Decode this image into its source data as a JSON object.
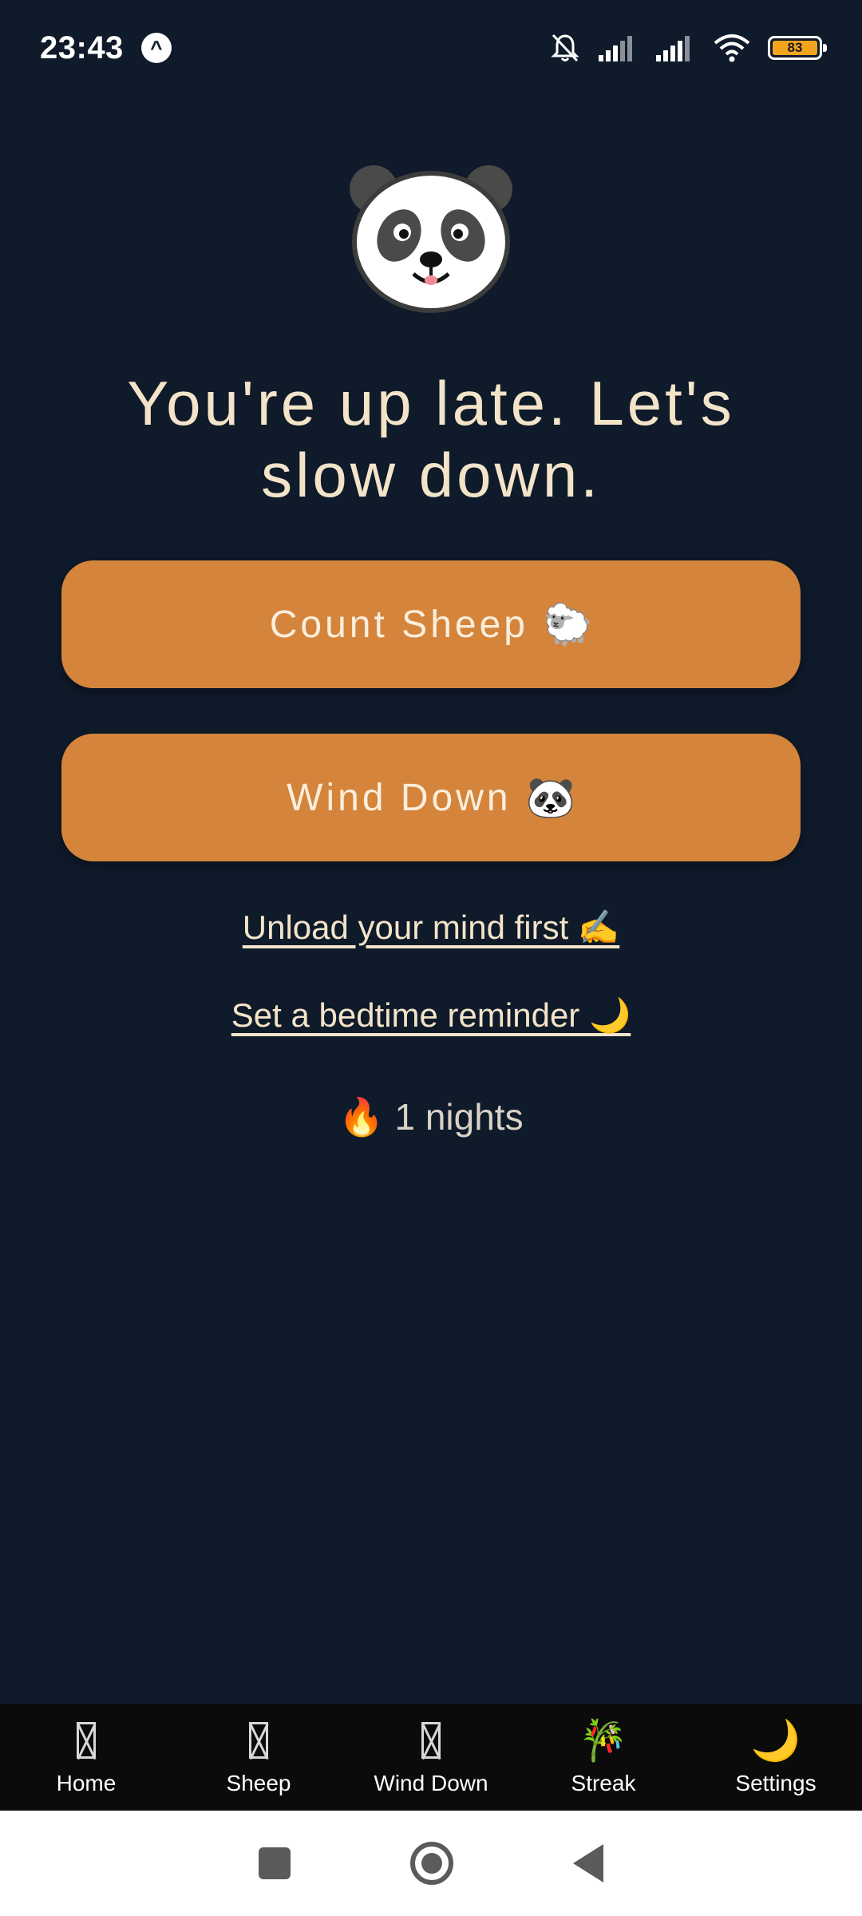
{
  "status_bar": {
    "time": "23:43",
    "battery_percent": "83",
    "app_badge_glyph": "^",
    "icons": [
      "app-notification-icon",
      "bell-muted-icon",
      "signal-icon",
      "signal-icon",
      "wifi-icon",
      "battery-icon"
    ]
  },
  "hero": {
    "mascot_icon": "panda-face-icon",
    "headline": "You're up late. Let's slow down."
  },
  "actions": {
    "count_sheep_label": "Count Sheep",
    "count_sheep_emoji": "🐑",
    "wind_down_label": "Wind Down",
    "wind_down_emoji": "🐼"
  },
  "links": {
    "unload_mind": "Unload your mind first ✍️",
    "bedtime_reminder": "Set a bedtime reminder 🌙"
  },
  "streak": {
    "emoji": "🔥",
    "text": "1 nights"
  },
  "tab_bar": {
    "items": [
      {
        "label": "Home",
        "icon": "missing-glyph-icon"
      },
      {
        "label": "Sheep",
        "icon": "missing-glyph-icon"
      },
      {
        "label": "Wind Down",
        "icon": "missing-glyph-icon"
      },
      {
        "label": "Streak",
        "icon": "bamboo-icon",
        "glyph": "🎋"
      },
      {
        "label": "Settings",
        "icon": "crescent-moon-icon",
        "glyph": "🌙"
      }
    ]
  },
  "colors": {
    "background": "#0f1a2a",
    "button": "#d4853b",
    "headline_text": "#f3e4c9",
    "tab_bar": "#0b0b0c",
    "battery_fill": "#f2a51c"
  }
}
